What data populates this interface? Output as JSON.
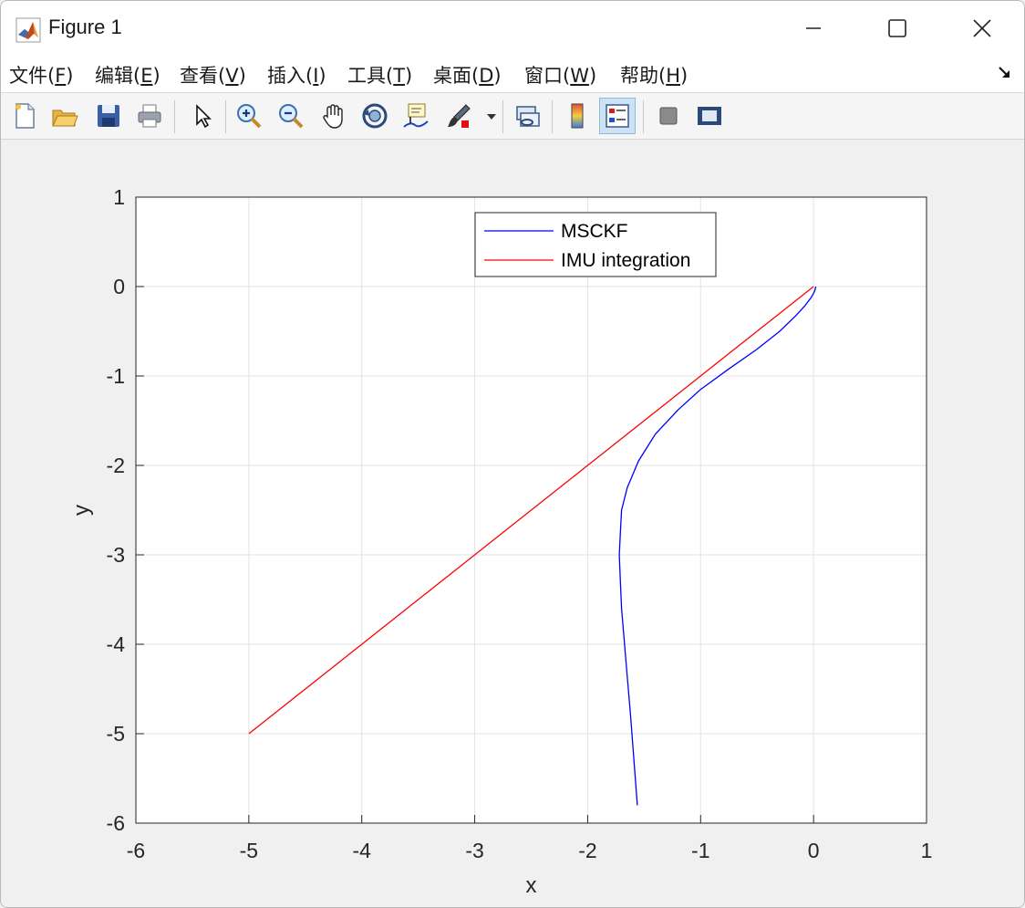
{
  "window": {
    "title": "Figure 1",
    "controls": {
      "minimize": "—",
      "maximize": "☐",
      "close": "✕"
    }
  },
  "menu": {
    "items": [
      {
        "pre": "文件(",
        "key": "F",
        "post": ")"
      },
      {
        "pre": "编辑(",
        "key": "E",
        "post": ")"
      },
      {
        "pre": "查看(",
        "key": "V",
        "post": ")"
      },
      {
        "pre": "插入(",
        "key": "I",
        "post": ")"
      },
      {
        "pre": "工具(",
        "key": "T",
        "post": ")"
      },
      {
        "pre": "桌面(",
        "key": "D",
        "post": ")"
      },
      {
        "pre": "窗口(",
        "key": "W",
        "post": ")"
      },
      {
        "pre": "帮助(",
        "key": "H",
        "post": ")"
      }
    ]
  },
  "toolbar": {
    "tools": [
      "new-figure-icon",
      "open-file-icon",
      "save-icon",
      "print-icon",
      "select-arrow-icon",
      "zoom-in-icon",
      "zoom-out-icon",
      "pan-hand-icon",
      "rotate-3d-icon",
      "data-cursor-icon",
      "brush-icon",
      "link-plot-icon",
      "colorbar-icon",
      "legend-icon",
      "hide-plot-tools-icon",
      "show-plot-tools-icon"
    ],
    "active": "legend-icon"
  },
  "chart_data": {
    "type": "line",
    "title": "",
    "xlabel": "x",
    "ylabel": "y",
    "xlim": [
      -6,
      1
    ],
    "ylim": [
      -6,
      1
    ],
    "xticks": [
      "-6",
      "-5",
      "-4",
      "-3",
      "-2",
      "-1",
      "0",
      "1"
    ],
    "yticks": [
      "1",
      "0",
      "-1",
      "-2",
      "-3",
      "-4",
      "-5",
      "-6"
    ],
    "grid": true,
    "legend": "top-center",
    "series": [
      {
        "name": "MSCKF",
        "color": "#0000ff",
        "x": [
          0.02,
          0.01,
          -0.02,
          -0.08,
          -0.16,
          -0.3,
          -0.5,
          -0.75,
          -1.0,
          -1.2,
          -1.4,
          -1.55,
          -1.65,
          -1.7,
          -1.71,
          -1.72,
          -1.71,
          -1.7,
          -1.66,
          -1.62,
          -1.59,
          -1.56
        ],
        "y": [
          0.0,
          -0.05,
          -0.12,
          -0.22,
          -0.33,
          -0.5,
          -0.7,
          -0.92,
          -1.15,
          -1.38,
          -1.65,
          -1.95,
          -2.25,
          -2.5,
          -2.75,
          -3.0,
          -3.3,
          -3.6,
          -4.2,
          -4.8,
          -5.3,
          -5.8
        ]
      },
      {
        "name": "IMU integration",
        "color": "#ff0000",
        "x": [
          -5,
          0
        ],
        "y": [
          -5,
          0
        ]
      }
    ]
  }
}
